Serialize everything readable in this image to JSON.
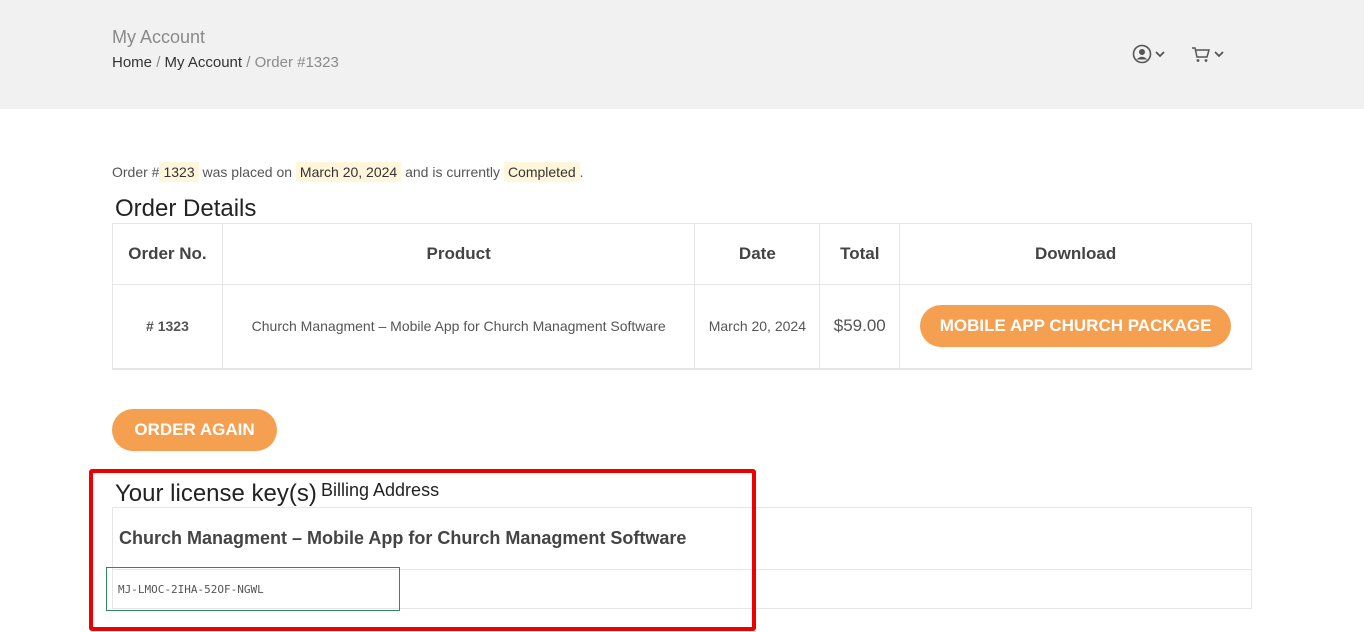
{
  "header": {
    "page_title": "My Account",
    "breadcrumb": {
      "home": "Home",
      "separator": "/",
      "account": "My Account",
      "current": "Order #1323"
    },
    "icons": [
      "user-icon",
      "cart-icon"
    ]
  },
  "order_summary": {
    "prefix": "Order #",
    "order_number": "1323",
    "placed_text": "was placed on",
    "date": "March 20, 2024",
    "status_text": "and is currently",
    "status": "Completed",
    "suffix": "."
  },
  "order_details": {
    "title": "Order Details",
    "columns": [
      "Order No.",
      "Product",
      "Date",
      "Total",
      "Download"
    ],
    "rows": [
      {
        "order_no": "# 1323",
        "product": "Church Managment – Mobile App for Church Managment Software",
        "date": "March 20, 2024",
        "total": "$59.00",
        "download_label": "MOBILE APP CHURCH PACKAGE"
      }
    ]
  },
  "order_again_label": "ORDER AGAIN",
  "license": {
    "title": "Your license key(s)",
    "billing_label": "Billing Address",
    "product": "Church Managment – Mobile App for Church Managment Software",
    "key": "MJ-LMOC-2IHA-52OF-NGWL"
  },
  "colors": {
    "accent": "#f5a050",
    "highlight_border": "#ee0000",
    "key_border": "#2f8a5a",
    "header_bg": "#f1f1f1",
    "mark_bg": "#fff6dc"
  }
}
